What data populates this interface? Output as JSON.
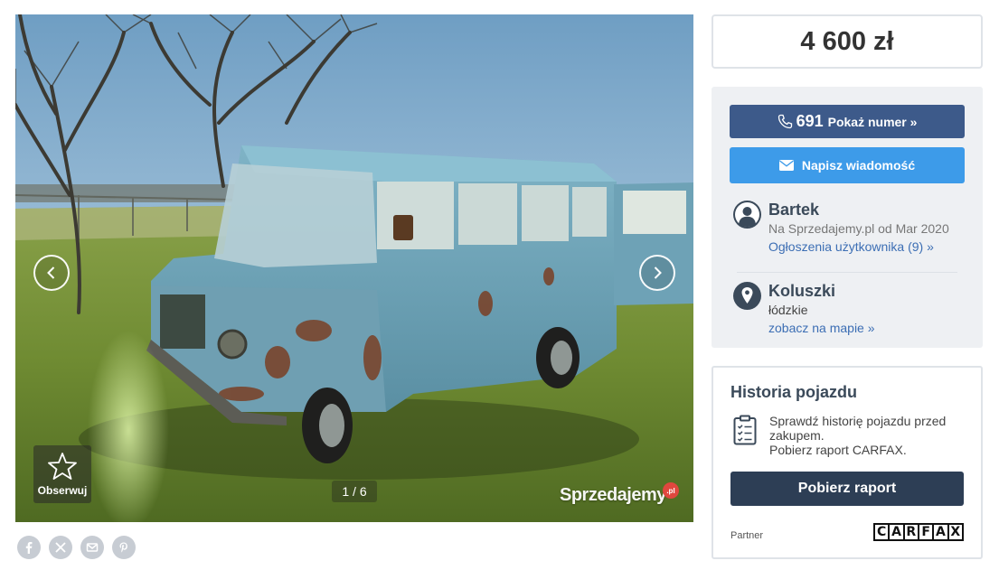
{
  "gallery": {
    "counter": "1 / 6",
    "watch_label": "Obserwuj",
    "watermark": "Sprzedajemy",
    "watermark_badge": ".pl",
    "photo_subject": "Blue rusty vintage minibus on a grassy field"
  },
  "share": {
    "icons": [
      "facebook-icon",
      "x-icon",
      "email-icon",
      "pinterest-icon"
    ]
  },
  "price": "4 600 zł",
  "contact": {
    "phone_number": "691",
    "phone_label": "Pokaż numer »",
    "message_label": "Napisz wiadomość"
  },
  "seller": {
    "name": "Bartek",
    "since": "Na Sprzedajemy.pl od Mar 2020",
    "listings_link": "Ogłoszenia użytkownika (9) »"
  },
  "location": {
    "city": "Koluszki",
    "region": "łódzkie",
    "map_link": "zobacz na mapie »"
  },
  "history": {
    "title": "Historia pojazdu",
    "text_line1": "Sprawdź historię pojazdu przed zakupem.",
    "text_line2": "Pobierz raport CARFAX.",
    "button_label": "Pobierz raport",
    "partner_label": "Partner",
    "partner_logo_letters": [
      "C",
      "A",
      "R",
      "F",
      "A",
      "X"
    ]
  },
  "colors": {
    "phone_button": "#3d5a8a",
    "message_button": "#3d9be9",
    "report_button": "#2d3e55",
    "link": "#3c6eb4"
  }
}
